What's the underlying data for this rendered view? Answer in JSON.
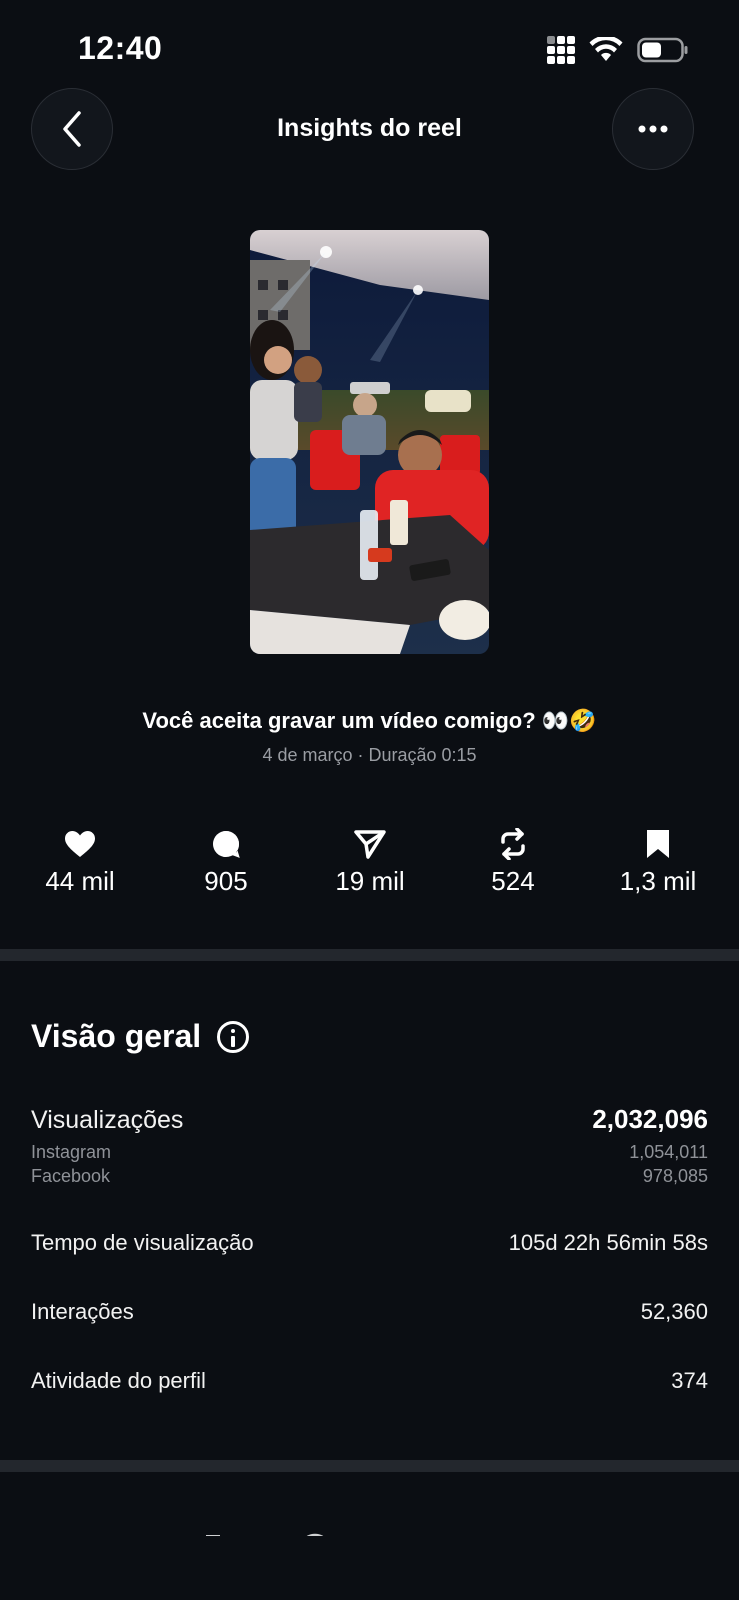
{
  "status_bar": {
    "time": "12:40"
  },
  "header": {
    "title": "Insights do reel",
    "back_icon": "chevron-left-icon",
    "more_icon": "ellipsis-icon"
  },
  "reel": {
    "caption": "Você aceita gravar um vídeo comigo? 👀🤣",
    "meta": "4 de março · Duração 0:15"
  },
  "stats": [
    {
      "icon": "heart-icon",
      "value": "44 mil"
    },
    {
      "icon": "comment-icon",
      "value": "905"
    },
    {
      "icon": "share-icon",
      "value": "19 mil"
    },
    {
      "icon": "repost-icon",
      "value": "524"
    },
    {
      "icon": "bookmark-icon",
      "value": "1,3 mil"
    }
  ],
  "overview": {
    "title": "Visão geral",
    "views": {
      "label": "Visualizações",
      "value": "2,032,096",
      "breakdown": [
        {
          "label": "Instagram",
          "value": "1,054,011"
        },
        {
          "label": "Facebook",
          "value": "978,085"
        }
      ]
    },
    "watch_time": {
      "label": "Tempo de visualização",
      "value": "105d 22h 56min 58s"
    },
    "interactions": {
      "label": "Interações",
      "value": "52,360"
    },
    "profile_activity": {
      "label": "Atividade do perfil",
      "value": "374"
    }
  },
  "colors": {
    "background": "#0b0e13",
    "divider": "#23272d",
    "muted_text": "#9a9da3"
  }
}
